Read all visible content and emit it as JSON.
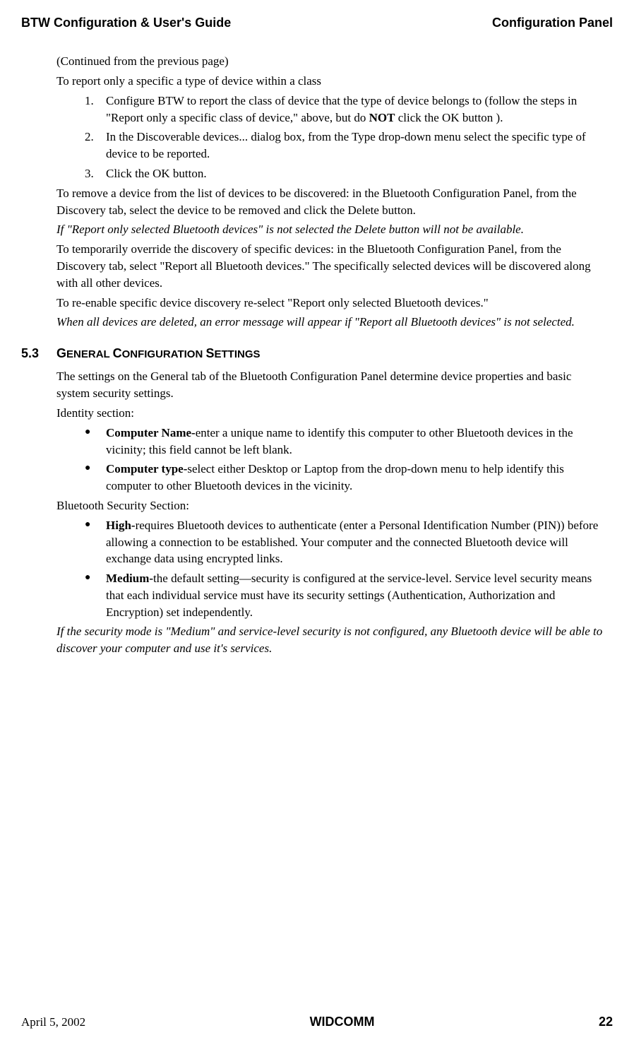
{
  "header": {
    "left": "BTW Configuration & User's Guide",
    "right": "Configuration Panel"
  },
  "p_continued": "(Continued from the previous page)",
  "p_report_intro": "To report only a specific a type of device within a class",
  "numbered_list": [
    {
      "num": "1.",
      "text_before": "Configure BTW to report the class of device that the type of device belongs to (follow the steps in \"Report only a specific class of device,\" above, but do ",
      "bold": "NOT",
      "text_after": " click the OK button )."
    },
    {
      "num": "2.",
      "text": "In the Discoverable devices... dialog box, from the Type drop-down menu select the specific type of device to be reported."
    },
    {
      "num": "3.",
      "text": "Click the OK button."
    }
  ],
  "p_remove": "To remove a device from the list of devices to be discovered: in the Bluetooth Configuration Panel, from the Discovery tab, select the device to be removed and click the Delete button.",
  "p_report_italic": "If \"Report only selected Bluetooth devices\" is not selected the Delete button will not be available.",
  "p_override": "To temporarily override the discovery of specific devices: in the Bluetooth Configuration Panel, from the Discovery tab, select \"Report all Bluetooth devices.\" The specifically selected devices will be discovered along with all other devices.",
  "p_reenable": "To re-enable specific device discovery re-select \"Report only selected Bluetooth devices.\"",
  "p_deleted_italic": "When all devices are deleted, an error message will appear if \"Report all Bluetooth devices\" is not selected.",
  "section": {
    "num": "5.3",
    "title_1": "G",
    "title_2": "ENERAL ",
    "title_3": "C",
    "title_4": "ONFIGURATION ",
    "title_5": "S",
    "title_6": "ETTINGS"
  },
  "p_settings": "The settings on the General tab of the Bluetooth Configuration Panel determine device properties and basic system security settings.",
  "p_identity": "Identity section:",
  "identity_list": [
    {
      "bold": "Computer Name-",
      "text": "enter a unique name to identify this computer to other Bluetooth devices in the vicinity; this field cannot be left blank."
    },
    {
      "bold": "Computer type-",
      "text": "select either Desktop or Laptop from the drop-down menu to help identify this computer to other Bluetooth devices in the vicinity."
    }
  ],
  "p_security": "Bluetooth Security Section:",
  "security_list": [
    {
      "bold": "High-",
      "text": "requires Bluetooth devices to authenticate (enter a Personal Identification Number (PIN)) before allowing a connection to be established. Your computer and the connected Bluetooth device will exchange data using encrypted links."
    },
    {
      "bold": "Medium-",
      "text": "the default setting—security is configured at the service-level. Service level security means that each individual service must have its security settings (Authentication, Authorization and Encryption) set independently."
    }
  ],
  "p_security_italic": "If the security mode is \"Medium\" and service-level security is not configured, any Bluetooth device will be able to discover your computer and use it's services.",
  "footer": {
    "date": "April 5, 2002",
    "center": "WIDCOMM",
    "page": "22"
  }
}
